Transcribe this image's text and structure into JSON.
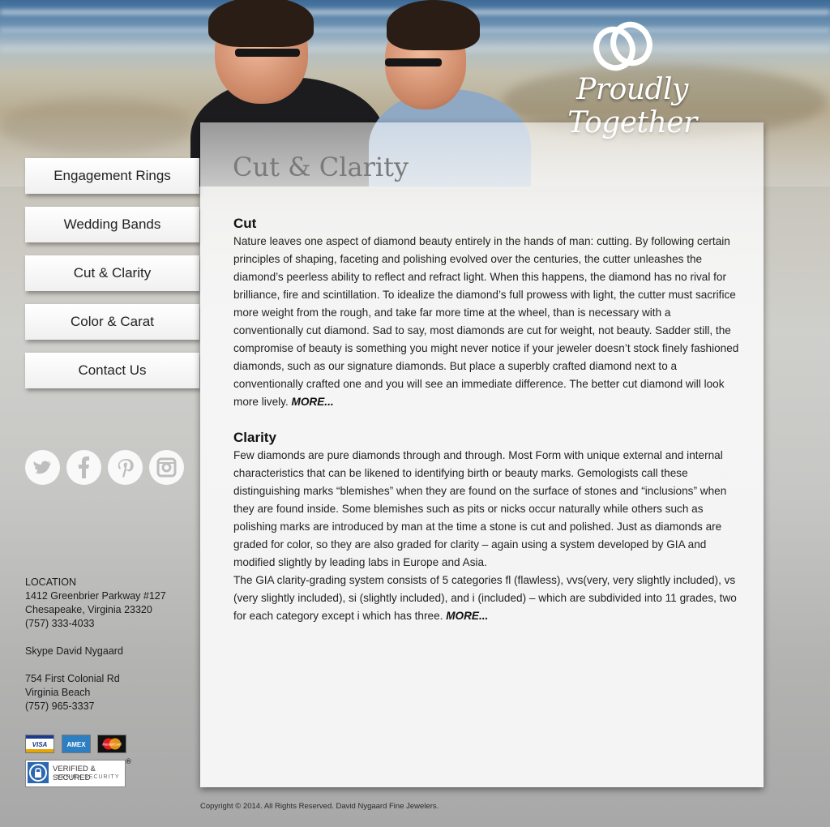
{
  "brand": {
    "logo_text": "Proudly Together"
  },
  "nav": {
    "items": [
      {
        "label": "Engagement Rings"
      },
      {
        "label": "Wedding  Bands"
      },
      {
        "label": "Cut & Clarity"
      },
      {
        "label": "Color & Carat"
      },
      {
        "label": "Contact Us"
      }
    ]
  },
  "social": {
    "icons": [
      "twitter-icon",
      "facebook-icon",
      "pinterest-icon",
      "instagram-icon"
    ]
  },
  "contact": {
    "heading": "LOCATION",
    "address1": "1412 Greenbrier Parkway #127",
    "address2": "Chesapeake, Virginia 23320",
    "phone1": "(757) 333-4033",
    "skype": "Skype David Nygaard",
    "address3": "754 First Colonial Rd",
    "address4": "Virginia Beach",
    "phone2": "(757) 965-3337"
  },
  "payments": {
    "visa": "VISA",
    "amex": "AMEX",
    "mastercard": "MasterCard",
    "verified_line1": "VERIFIED & SECURED",
    "verified_line2": "VERIFY SECURITY",
    "reg_mark": "®"
  },
  "main": {
    "title": "Cut & Clarity",
    "cut": {
      "heading": "Cut",
      "body": "Nature leaves one aspect of diamond beauty entirely in the hands of man: cutting. By following certain principles of shaping, faceting and polishing evolved over the centuries, the cutter unleashes the diamond’s peerless ability to reflect and refract light. When this happens, the diamond has no rival for brilliance, fire and scintillation. To idealize the diamond’s full prowess with light, the cutter must sacrifice more weight from the rough, and take far more time at the wheel, than is necessary with a conventionally cut diamond. Sad to say, most diamonds are cut for weight, not beauty. Sadder still, the compromise of beauty is something you might never notice if your jeweler doesn’t stock finely fashioned diamonds, such as our signature diamonds. But place a superbly crafted diamond next to a conventionally crafted one and you will see an immediate difference. The better cut diamond will look more lively. ",
      "more": "MORE..."
    },
    "clarity": {
      "heading": "Clarity",
      "body": "Few diamonds are pure diamonds through and through. Most Form with unique external and internal characteristics that can be likened to identifying birth or beauty marks. Gemologists call these distinguishing marks “blemishes” when they are found on the surface of stones and “inclusions” when they are found inside. Some blemishes such as pits or nicks occur naturally while others such as polishing marks are introduced by man at the time a stone is cut and polished. Just as diamonds are graded for color, so they are also graded for clarity – again using a system developed by GIA and modified slightly by leading labs in Europe and Asia.",
      "body2": "The GIA clarity-grading system consists of 5 categories fl (flawless), vvs(very, very slightly included), vs (very slightly included), si (slightly included), and i (included) – which are subdivided into 11 grades, two for each category except i which has three. ",
      "more": "MORE..."
    }
  },
  "footer": {
    "copyright": "Copyright © 2014. All Rights Reserved. David Nygaard Fine Jewelers."
  }
}
